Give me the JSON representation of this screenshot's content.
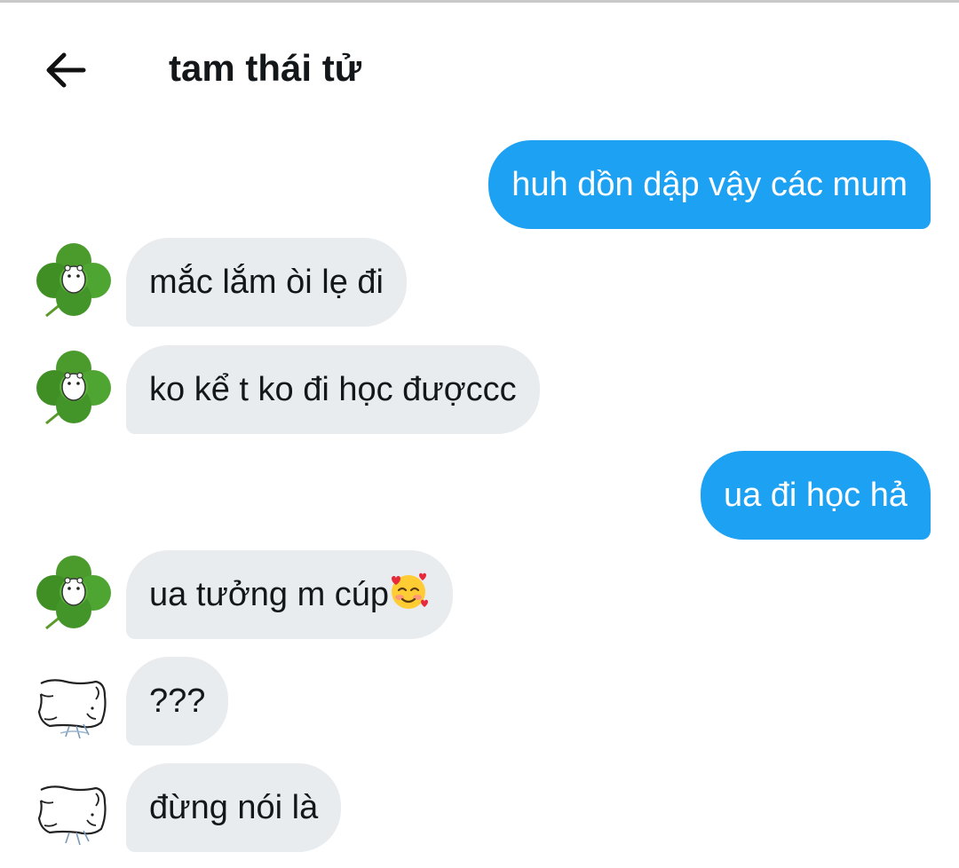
{
  "header": {
    "back_icon": "arrow-left-icon",
    "title": "tam thái tử"
  },
  "messages": [
    {
      "side": "out",
      "text": "huh dồn dập vậy các mum"
    },
    {
      "side": "in",
      "avatar": "clover-avatar",
      "text": "mắc lắm òi lẹ đi"
    },
    {
      "side": "in",
      "avatar": "clover-avatar",
      "text": "ko kể t ko đi học đượccc"
    },
    {
      "side": "out",
      "text": "ua đi học hả"
    },
    {
      "side": "in",
      "avatar": "clover-avatar",
      "text": "ua tưởng m cúp",
      "emoji": "smiling-face-with-hearts-emoji"
    },
    {
      "side": "in",
      "avatar": "sketch-animal-avatar",
      "text": "???"
    },
    {
      "side": "in",
      "avatar": "sketch-animal-avatar",
      "text": "đừng nói là"
    }
  ],
  "colors": {
    "outgoing_bubble": "#1da1f2",
    "incoming_bubble": "#e8ecef",
    "text": "#14171a"
  }
}
